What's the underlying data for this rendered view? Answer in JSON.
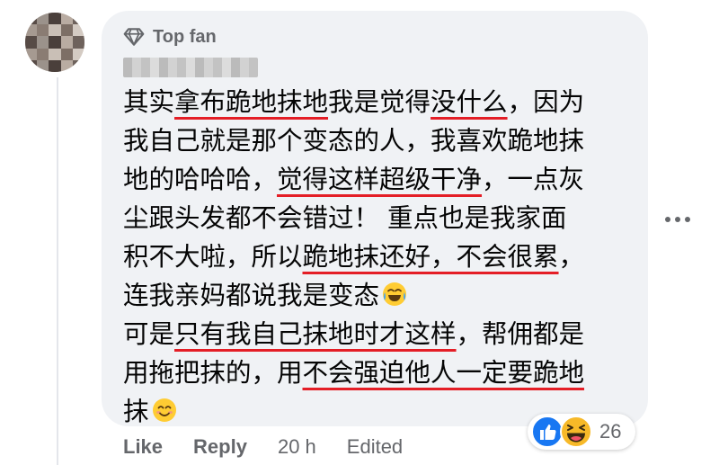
{
  "comment": {
    "badge": {
      "icon": "diamond-icon",
      "label": "Top fan"
    },
    "text_lines": [
      [
        {
          "t": "其实",
          "u": false
        },
        {
          "t": "拿布跪地抹地",
          "u": true
        },
        {
          "t": "我是觉得",
          "u": false
        },
        {
          "t": "没什么",
          "u": true
        },
        {
          "t": "，因为",
          "u": false
        }
      ],
      [
        {
          "t": "我自己就是那个变态的人，我喜欢跪地抹",
          "u": false
        }
      ],
      [
        {
          "t": "地的哈哈哈，",
          "u": false
        },
        {
          "t": "觉得这样超级干净",
          "u": true
        },
        {
          "t": "，一点灰",
          "u": false
        }
      ],
      [
        {
          "t": "尘跟头发都不会错过！ 重点也是我家面",
          "u": false
        }
      ],
      [
        {
          "t": "积不大啦，所以",
          "u": false
        },
        {
          "t": "跪地抹还好，不会很累",
          "u": true
        },
        {
          "t": "，",
          "u": false
        }
      ],
      [
        {
          "t": "连我亲妈都说我是变态",
          "u": false
        },
        {
          "emoji": "joy-emoji"
        }
      ],
      [
        {
          "t": "可是",
          "u": false
        },
        {
          "t": "只有我自己抹地时才这样",
          "u": true
        },
        {
          "t": "，帮佣都是",
          "u": false
        }
      ],
      [
        {
          "t": "用拖把抹的，用",
          "u": false
        },
        {
          "t": "不会强迫他人一定要跪地",
          "u": true
        }
      ],
      [
        {
          "t": "抹",
          "u": false
        },
        {
          "emoji": "smile-emoji"
        }
      ]
    ],
    "underline_color": "#e41e26"
  },
  "reactions": {
    "icons": [
      "like-reaction-icon",
      "haha-reaction-icon"
    ],
    "count": "26"
  },
  "actions": {
    "like_label": "Like",
    "reply_label": "Reply",
    "time": "20 h",
    "edited_label": "Edited"
  },
  "colors": {
    "bubble": "#f0f2f5",
    "secondary_text": "#65676b",
    "like_blue": "#1877f2",
    "haha_yellow": "#f7b928"
  }
}
